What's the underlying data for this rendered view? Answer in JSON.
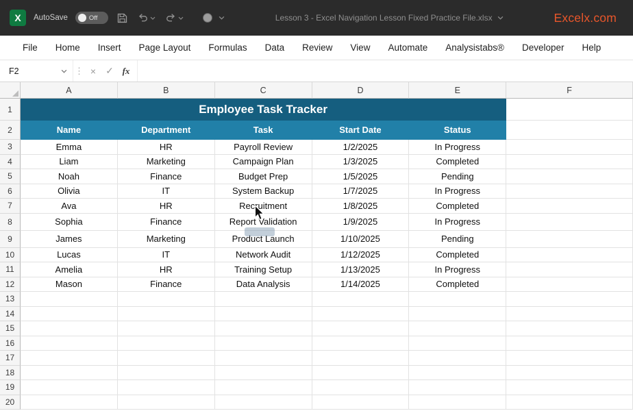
{
  "titlebar": {
    "autosave_label": "AutoSave",
    "autosave_state": "Off",
    "document_title": "Lesson 3 - Excel Navigation Lesson Fixed Practice File.xlsx",
    "brand": "Excelx.com",
    "brand_color": "#E8562B"
  },
  "menu": {
    "tabs": [
      "File",
      "Home",
      "Insert",
      "Page Layout",
      "Formulas",
      "Data",
      "Review",
      "View",
      "Automate",
      "Analysistabs®",
      "Developer",
      "Help"
    ]
  },
  "formula_bar": {
    "name_box_value": "F2",
    "formula_value": "",
    "icons": {
      "cancel": "×",
      "enter": "✓",
      "function": "fx",
      "dots": "⋮"
    }
  },
  "sheet": {
    "columns": [
      "A",
      "B",
      "C",
      "D",
      "E",
      "F"
    ],
    "visible_row_count": 20,
    "table": {
      "title": "Employee Task Tracker",
      "headers": [
        "Name",
        "Department",
        "Task",
        "Start Date",
        "Status"
      ],
      "rows": [
        [
          "Emma",
          "HR",
          "Payroll Review",
          "1/2/2025",
          "In Progress"
        ],
        [
          "Liam",
          "Marketing",
          "Campaign Plan",
          "1/3/2025",
          "Completed"
        ],
        [
          "Noah",
          "Finance",
          "Budget Prep",
          "1/5/2025",
          "Pending"
        ],
        [
          "Olivia",
          "IT",
          "System Backup",
          "1/7/2025",
          "In Progress"
        ],
        [
          "Ava",
          "HR",
          "Recruitment",
          "1/8/2025",
          "Completed"
        ],
        [
          "Sophia",
          "Finance",
          "Report Validation",
          "1/9/2025",
          "In Progress"
        ],
        [
          "James",
          "Marketing",
          "Product Launch",
          "1/10/2025",
          "Pending"
        ],
        [
          "Lucas",
          "IT",
          "Network Audit",
          "1/12/2025",
          "Completed"
        ],
        [
          "Amelia",
          "HR",
          "Training Setup",
          "1/13/2025",
          "In Progress"
        ],
        [
          "Mason",
          "Finance",
          "Data Analysis",
          "1/14/2025",
          "Completed"
        ]
      ]
    },
    "colors": {
      "title_bg": "#155E7F",
      "header_bg": "#2180A8"
    }
  }
}
